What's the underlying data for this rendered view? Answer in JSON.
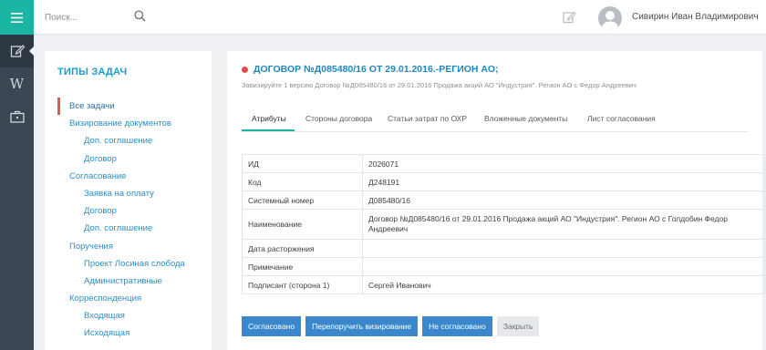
{
  "search": {
    "placeholder": "Поиск..."
  },
  "user": {
    "name": "Сивирин Иван Владимирович"
  },
  "nav_rail": {
    "items": [
      {
        "icon": "menu-icon"
      },
      {
        "icon": "edit-icon",
        "active": true
      },
      {
        "icon": "wiki-icon",
        "label": "W"
      },
      {
        "icon": "briefcase-icon"
      }
    ]
  },
  "left_panel": {
    "title": "ТИПЫ ЗАДАЧ",
    "items": [
      {
        "label": "Все задачи",
        "level": 0,
        "selected": true
      },
      {
        "label": "Визирование документов",
        "level": 0
      },
      {
        "label": "Доп. соглашение",
        "level": 1
      },
      {
        "label": "Договор",
        "level": 1
      },
      {
        "label": "Согласование",
        "level": 0
      },
      {
        "label": "Заявка на оплату",
        "level": 1
      },
      {
        "label": "Договор",
        "level": 1
      },
      {
        "label": "Доп. соглашение",
        "level": 1
      },
      {
        "label": "Поручения",
        "level": 0
      },
      {
        "label": "Проект Лосиная слобода",
        "level": 1
      },
      {
        "label": "Административные",
        "level": 1
      },
      {
        "label": "Корреспонденция",
        "level": 0
      },
      {
        "label": "Входящая",
        "level": 1
      },
      {
        "label": "Исходящая",
        "level": 1
      }
    ]
  },
  "main": {
    "title": "ДОГОВОР №Д085480/16 ОТ 29.01.2016.-РЕГИОН АО;",
    "subtitle": "Завизируйте 1 версию Договор №Д085480/16 от 29.01.2016 Продажа акций АО \"Индустрия\". Регион АО с Федор Андреевич",
    "status_color": "#e24b4b",
    "tabs": [
      {
        "label": "Атрибуты",
        "active": true
      },
      {
        "label": "Стороны договора"
      },
      {
        "label": "Статьи затрат по ОХР"
      },
      {
        "label": "Вложенные документы"
      },
      {
        "label": "Лист согласования"
      }
    ],
    "attributes": [
      {
        "key": "ИД",
        "value": "2026071"
      },
      {
        "key": "Код",
        "value": "Д248191"
      },
      {
        "key": "Системный номер",
        "value": "Д085480/16"
      },
      {
        "key": "Наименование",
        "value": "Договор №Д085480/16 от 29.01.2016 Продажа акций АО \"Индустрия\". Регион АО с Голдобин Федор Андреевич"
      },
      {
        "key": "Дата расторжения",
        "value": ""
      },
      {
        "key": "Примечание",
        "value": ""
      },
      {
        "key": "Подписант (сторона 1)",
        "value": "Сергей Иванович"
      }
    ],
    "actions": [
      {
        "label": "Согласовано"
      },
      {
        "label": "Перепоручить визирование"
      },
      {
        "label": "Не согласовано"
      },
      {
        "label": "Закрыть"
      }
    ]
  },
  "colors": {
    "accent": "#1ab5a3",
    "link": "#2c8fc6",
    "primary_button": "#3a87cc",
    "rail": "#3a4652"
  }
}
